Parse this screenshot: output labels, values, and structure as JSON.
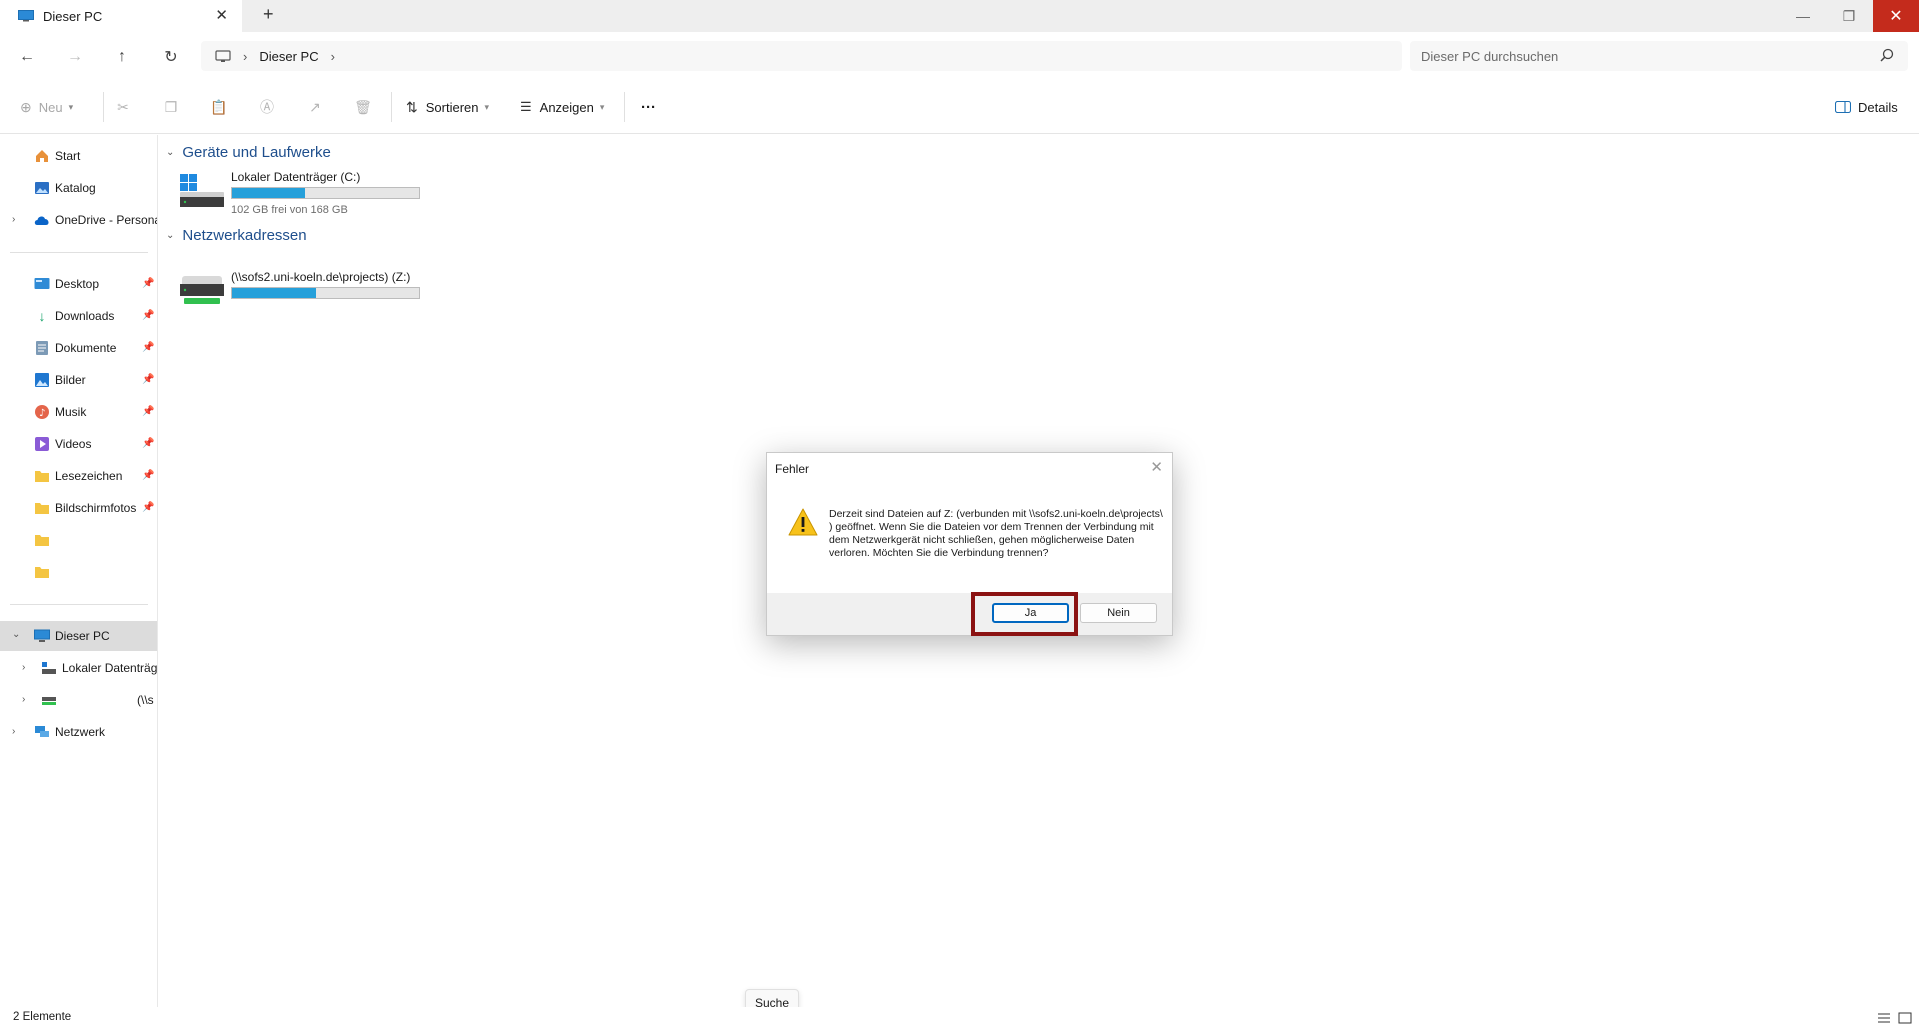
{
  "window": {
    "tab_title": "Dieser PC",
    "minimize_glyph": "—",
    "restore_glyph": "❐",
    "close_glyph": "✕"
  },
  "address": {
    "breadcrumb": [
      "Dieser PC"
    ],
    "search_placeholder": "Dieser PC durchsuchen"
  },
  "toolbar": {
    "new_label": "Neu",
    "sort_label": "Sortieren",
    "view_label": "Anzeigen",
    "more_label": "···",
    "details_label": "Details"
  },
  "sidebar": {
    "quick": [
      {
        "label": "Start",
        "icon": "home-icon"
      },
      {
        "label": "Katalog",
        "icon": "gallery-icon"
      },
      {
        "label": "OneDrive - Persona",
        "icon": "onedrive-icon",
        "expandable": true
      }
    ],
    "pinned": [
      {
        "label": "Desktop",
        "icon": "desktop-folder-icon"
      },
      {
        "label": "Downloads",
        "icon": "downloads-icon"
      },
      {
        "label": "Dokumente",
        "icon": "documents-icon"
      },
      {
        "label": "Bilder",
        "icon": "pictures-icon"
      },
      {
        "label": "Musik",
        "icon": "music-icon"
      },
      {
        "label": "Videos",
        "icon": "videos-icon"
      },
      {
        "label": "Lesezeichen",
        "icon": "folder-icon"
      },
      {
        "label": "Bildschirmfotos",
        "icon": "folder-icon"
      },
      {
        "label": "",
        "icon": "folder-icon"
      },
      {
        "label": "",
        "icon": "folder-icon"
      }
    ],
    "tree": {
      "this_pc": "Dieser PC",
      "local_drive": "Lokaler Datenträg",
      "network_drive": "(\\\\s",
      "network": "Netzwerk"
    }
  },
  "content": {
    "groups": [
      {
        "title": "Geräte und Laufwerke",
        "items": [
          {
            "name": "Lokaler Datenträger (C:)",
            "subtitle": "102 GB frei von 168 GB",
            "used_fraction": 0.39
          }
        ]
      },
      {
        "title": "Netzwerkadressen",
        "items": [
          {
            "name": "(\\\\sofs2.uni-koeln.de\\projects) (Z:)",
            "subtitle": "",
            "used_fraction": 0.45
          }
        ]
      }
    ]
  },
  "dialog": {
    "title": "Fehler",
    "message": "Derzeit sind Dateien auf Z: (verbunden mit \\\\sofs2.uni-koeln.de\\projects\\                    ) geöffnet. Wenn Sie die Dateien vor dem Trennen der Verbindung mit dem Netzwerkgerät nicht schließen, gehen möglicherweise Daten verloren. Möchten Sie die Verbindung trennen?",
    "yes_label": "Ja",
    "no_label": "Nein"
  },
  "status": {
    "item_count": "2 Elemente",
    "tooltip": "Suche"
  },
  "colors": {
    "accent": "#0067c0",
    "progress": "#26a0da",
    "highlight": "#8b1212",
    "close_red": "#c42b1c"
  }
}
